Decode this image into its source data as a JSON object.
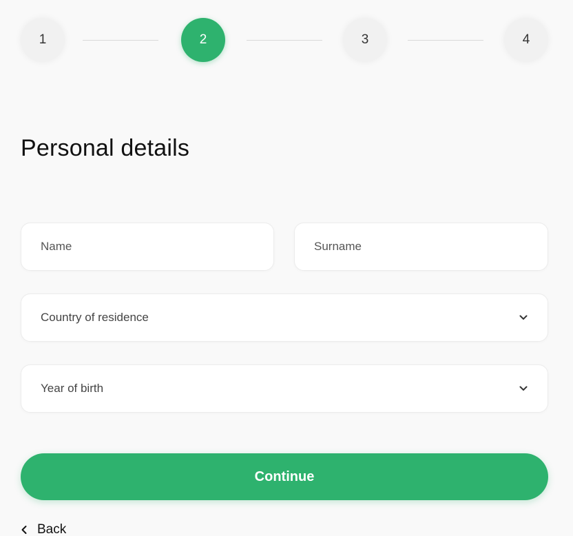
{
  "stepper": {
    "steps": [
      {
        "label": "1",
        "active": false
      },
      {
        "label": "2",
        "active": true
      },
      {
        "label": "3",
        "active": false
      },
      {
        "label": "4",
        "active": false
      }
    ],
    "accent_color": "#2eb26e"
  },
  "form": {
    "title": "Personal details",
    "name_placeholder": "Name",
    "surname_placeholder": "Surname",
    "country_select": "Country of residence",
    "year_select": "Year of birth",
    "continue_label": "Continue"
  },
  "navigation": {
    "back_label": "Back"
  },
  "icons": {
    "select_chevron": "chevron-down-icon",
    "back_chevron": "chevron-left-icon"
  }
}
